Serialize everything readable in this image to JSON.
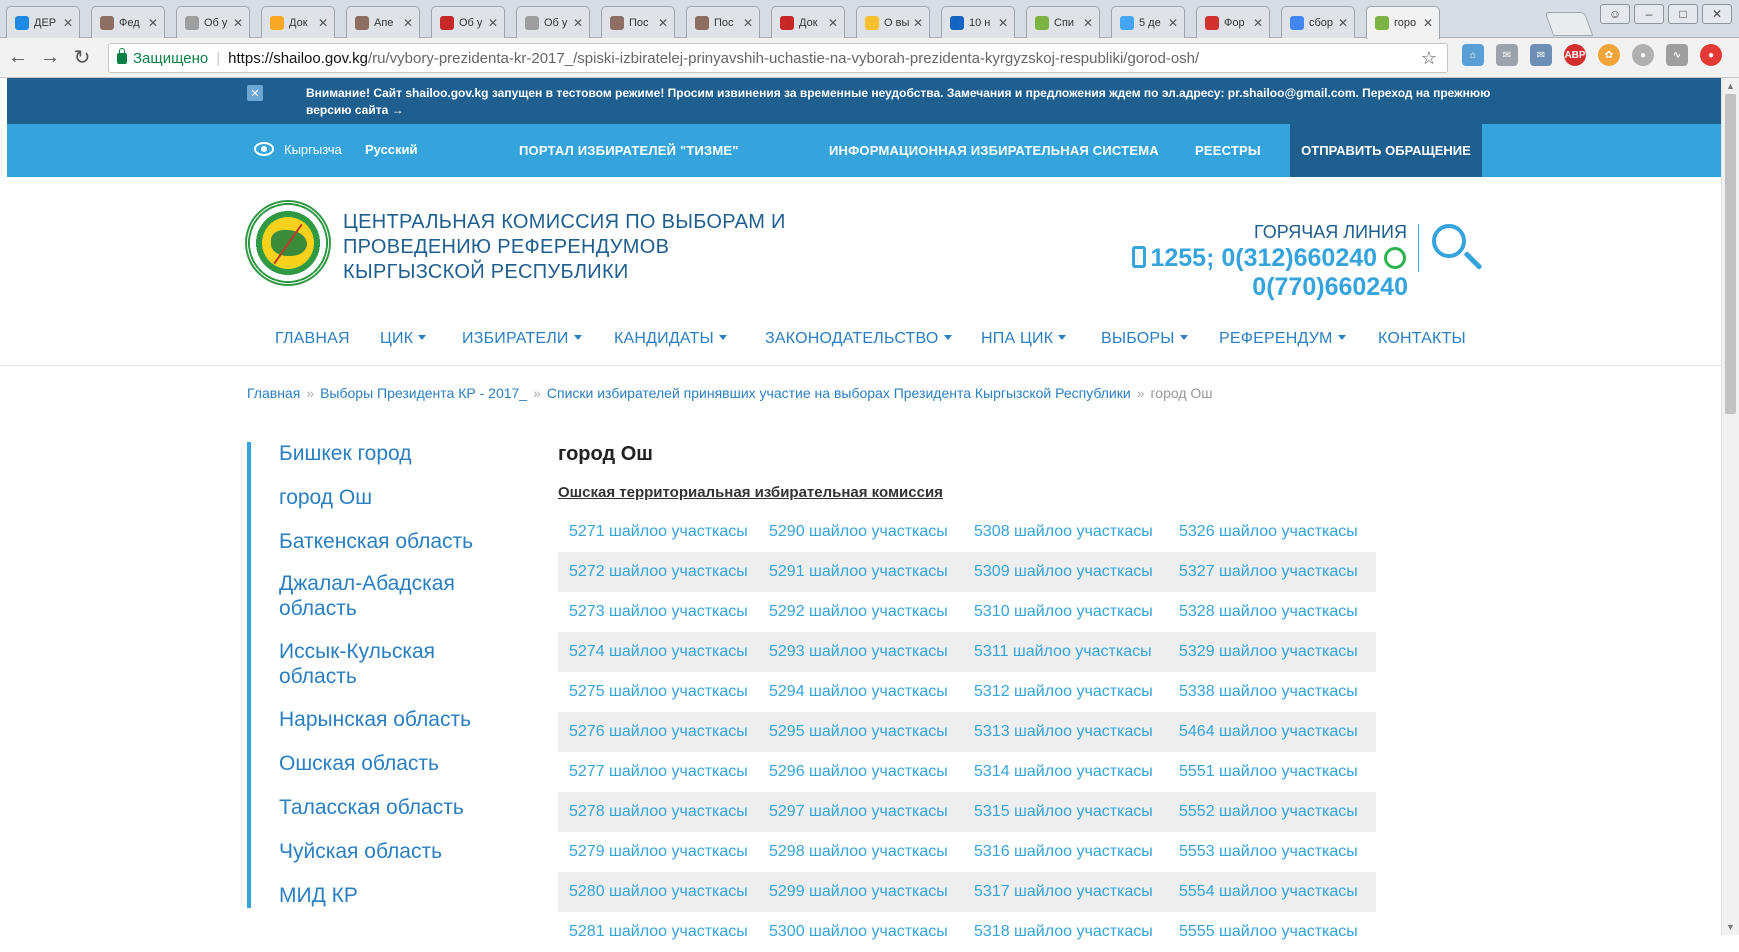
{
  "browser": {
    "tabs": [
      {
        "label": "ДЕР",
        "color": "#1e88e5"
      },
      {
        "label": "Фед",
        "color": "#8d6e63"
      },
      {
        "label": "Об у",
        "color": "#9e9e9e"
      },
      {
        "label": "Док",
        "color": "#f9a825"
      },
      {
        "label": "Апе",
        "color": "#8d6e63"
      },
      {
        "label": "Об у",
        "color": "#c62828"
      },
      {
        "label": "Об у",
        "color": "#9e9e9e"
      },
      {
        "label": "Пос",
        "color": "#8d6e63"
      },
      {
        "label": "Пос",
        "color": "#8d6e63"
      },
      {
        "label": "Док",
        "color": "#c62828"
      },
      {
        "label": "О вы",
        "color": "#fbc02d"
      },
      {
        "label": "10 н",
        "color": "#1565c0"
      },
      {
        "label": "Спи",
        "color": "#7cb342"
      },
      {
        "label": "5 де",
        "color": "#42a5f5"
      },
      {
        "label": "Фор",
        "color": "#d32f2f"
      },
      {
        "label": "сбор",
        "color": "#4285f4"
      },
      {
        "label": "горо",
        "color": "#7cb342"
      }
    ],
    "secure_label": "Защищено",
    "url_host": "https://shailoo.gov.kg",
    "url_path": "/ru/vybory-prezidenta-kr-2017_/spiski-izbiratelej-prinyavshih-uchastie-na-vyborah-prezidenta-kyrgyzskoj-respubliki/gorod-osh/"
  },
  "notice": {
    "text": "Внимание! Сайт shailoo.gov.kg запущен в тестовом режиме! Просим извинения за временные неудобства. Замечания и предложения ждем по эл.адресу: pr.shailoo@gmail.com. Переход на прежнюю версию сайта →"
  },
  "topnav": {
    "lang_ky": "Кыргызча",
    "lang_ru": "Русский",
    "links": [
      "ПОРТАЛ ИЗБИРАТЕЛЕЙ \"ТИЗМЕ\"",
      "ИНФОРМАЦИОННАЯ ИЗБИРАТЕЛЬНАЯ СИСТЕМА",
      "РЕЕСТРЫ"
    ],
    "send": "ОТПРАВИТЬ ОБРАЩЕНИЕ"
  },
  "header": {
    "org_name": "ЦЕНТРАЛЬНАЯ КОМИССИЯ ПО ВЫБОРАМ И ПРОВЕДЕНИЮ РЕФЕРЕНДУМОВ КЫРГЫЗСКОЙ РЕСПУБЛИКИ",
    "hotline_label": "ГОРЯЧАЯ ЛИНИЯ",
    "hotline_1": "1255; 0(312)660240",
    "hotline_2": "0(770)660240"
  },
  "menu": [
    {
      "label": "ГЛАВНАЯ",
      "caret": false
    },
    {
      "label": "ЦИК",
      "caret": true
    },
    {
      "label": "ИЗБИРАТЕЛИ",
      "caret": true
    },
    {
      "label": "КАНДИДАТЫ",
      "caret": true
    },
    {
      "label": "ЗАКОНОДАТЕЛЬСТВО",
      "caret": true
    },
    {
      "label": "НПА ЦИК",
      "caret": true
    },
    {
      "label": "ВЫБОРЫ",
      "caret": true
    },
    {
      "label": "РЕФЕРЕНДУМ",
      "caret": true
    },
    {
      "label": "КОНТАКТЫ",
      "caret": false
    }
  ],
  "breadcrumb": {
    "items": [
      "Главная",
      "Выборы Президента КР - 2017_",
      "Списки избирателей принявших участие на выборах Президента Кыргызской Республики"
    ],
    "current": "город Ош"
  },
  "sidebar": {
    "items": [
      "Бишкек город",
      "город Ош",
      "Баткенская область",
      "Джалал-Абадская область",
      "Иссык-Кульская область",
      "Нарынская область",
      "Ошская область",
      "Таласская область",
      "Чуйская область",
      "МИД КР"
    ]
  },
  "content": {
    "title": "город Ош",
    "subtitle": "Ошская территориальная избирательная комиссия",
    "suffix": "шайлоо участкасы",
    "rows": [
      [
        "5271",
        "5290",
        "5308",
        "5326"
      ],
      [
        "5272",
        "5291",
        "5309",
        "5327"
      ],
      [
        "5273",
        "5292",
        "5310",
        "5328"
      ],
      [
        "5274",
        "5293",
        "5311",
        "5329"
      ],
      [
        "5275",
        "5294",
        "5312",
        "5338"
      ],
      [
        "5276",
        "5295",
        "5313",
        "5464"
      ],
      [
        "5277",
        "5296",
        "5314",
        "5551"
      ],
      [
        "5278",
        "5297",
        "5315",
        "5552"
      ],
      [
        "5279",
        "5298",
        "5316",
        "5553"
      ],
      [
        "5280",
        "5299",
        "5317",
        "5554"
      ],
      [
        "5281",
        "5300",
        "5318",
        "5555"
      ]
    ]
  }
}
